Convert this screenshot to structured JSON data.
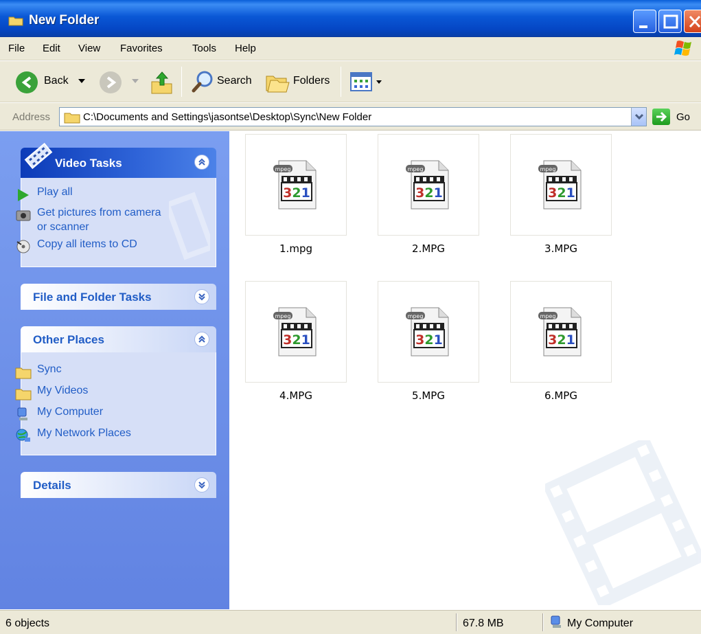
{
  "window": {
    "title": "New Folder"
  },
  "menu": [
    "File",
    "Edit",
    "View",
    "Favorites",
    "Tools",
    "Help"
  ],
  "toolbar": {
    "back_label": "Back",
    "search_label": "Search",
    "folders_label": "Folders"
  },
  "address": {
    "label": "Address",
    "path": "C:\\Documents and Settings\\jasontse\\Desktop\\Sync\\New Folder",
    "go_label": "Go"
  },
  "sidebar": {
    "video_tasks": {
      "title": "Video Tasks",
      "items": [
        "Play all",
        "Get pictures from camera",
        "or scanner",
        "Copy all items to CD"
      ]
    },
    "file_folder_tasks": {
      "title": "File and Folder Tasks"
    },
    "other_places": {
      "title": "Other Places",
      "items": [
        "Sync",
        "My Videos",
        "My Computer",
        "My Network Places"
      ]
    },
    "details": {
      "title": "Details"
    }
  },
  "files": [
    "1.mpg",
    "2.MPG",
    "3.MPG",
    "4.MPG",
    "5.MPG",
    "6.MPG"
  ],
  "file_icon": {
    "badge": "mpeg",
    "digits": "321"
  },
  "status": {
    "objects": "6 objects",
    "size": "67.8 MB",
    "zone": "My Computer"
  }
}
